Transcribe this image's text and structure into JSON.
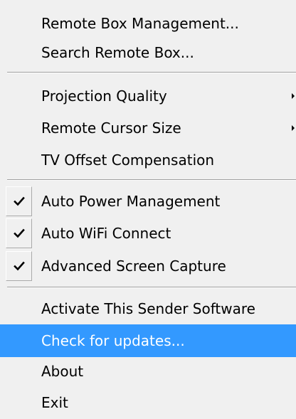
{
  "menu": {
    "items": [
      {
        "label": "Remote Box Management..."
      },
      {
        "label": "Search Remote Box..."
      },
      {
        "label": "Projection Quality",
        "submenu": true
      },
      {
        "label": "Remote Cursor Size",
        "submenu": true
      },
      {
        "label": "TV Offset Compensation"
      },
      {
        "label": "Auto Power Management",
        "checked": true
      },
      {
        "label": "Auto WiFi Connect",
        "checked": true
      },
      {
        "label": "Advanced Screen Capture",
        "checked": true
      },
      {
        "label": "Activate This Sender Software"
      },
      {
        "label": "Check for updates...",
        "highlighted": true
      },
      {
        "label": "About"
      },
      {
        "label": "Exit"
      }
    ],
    "icons": {
      "check": "check-icon",
      "submenu": "submenu-arrow-icon"
    },
    "colors": {
      "background": "#f0f0f0",
      "highlight": "#3399ff",
      "highlight_text": "#ffffff"
    }
  }
}
